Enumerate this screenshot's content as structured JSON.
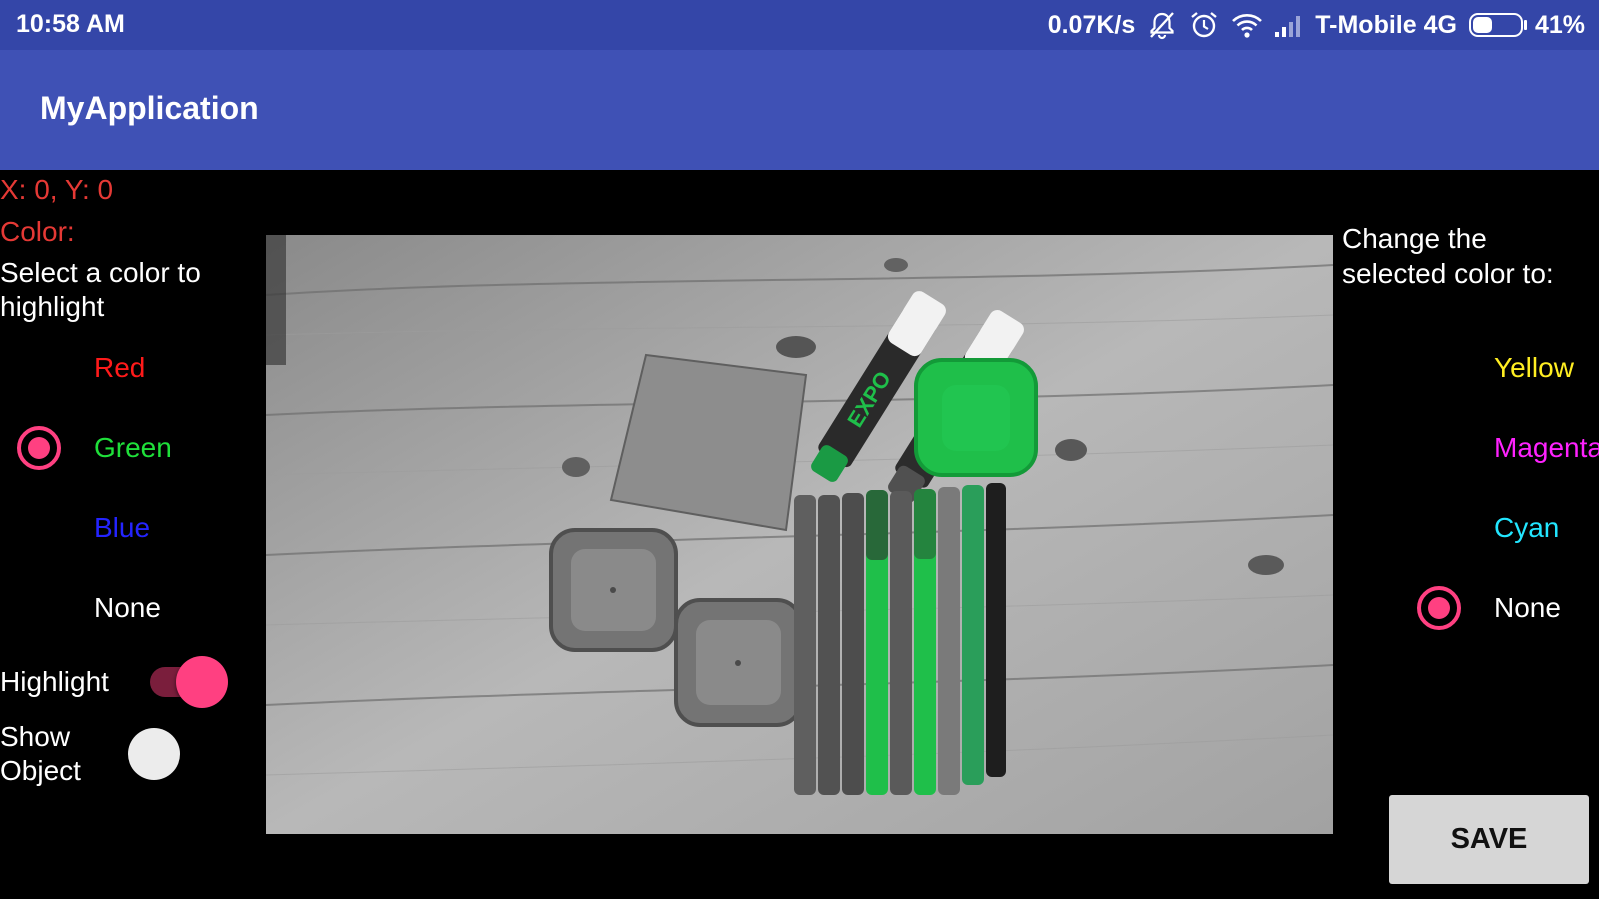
{
  "status_bar": {
    "time": "10:58 AM",
    "net_speed": "0.07K/s",
    "carrier": "T-Mobile 4G",
    "battery_percent": "41%",
    "battery_level": 0.41,
    "icons": [
      "bell-off-icon",
      "alarm-icon",
      "wifi-icon",
      "signal-icon",
      "battery-icon"
    ]
  },
  "app_bar": {
    "title": "MyApplication"
  },
  "left_panel": {
    "coords": "X: 0, Y: 0",
    "color_label": "Color:",
    "select_prompt": "Select a color to highlight",
    "options": [
      {
        "label": "Red",
        "color": "#ff1a1a",
        "checked": false
      },
      {
        "label": "Green",
        "color": "#1fe03a",
        "checked": true
      },
      {
        "label": "Blue",
        "color": "#2424ff",
        "checked": false
      },
      {
        "label": "None",
        "color": "#ffffff",
        "checked": false
      }
    ],
    "highlight_label": "Highlight",
    "highlight_on": true,
    "show_object_label": "Show Object",
    "show_object_on": false
  },
  "right_panel": {
    "change_prompt": "Change the selected color to:",
    "options": [
      {
        "label": "Yellow",
        "color": "#ffee22",
        "checked": false
      },
      {
        "label": "Magenta",
        "color": "#ff22ff",
        "checked": false
      },
      {
        "label": "Cyan",
        "color": "#22e6ff",
        "checked": false
      },
      {
        "label": "None",
        "color": "#ffffff",
        "checked": true
      }
    ]
  },
  "save_button": {
    "label": "SAVE"
  },
  "colors": {
    "status_bar_bg": "#3446a8",
    "app_bar_bg": "#3f51b5",
    "accent": "#ff4081",
    "highlight_green": "#1fbf4a"
  }
}
